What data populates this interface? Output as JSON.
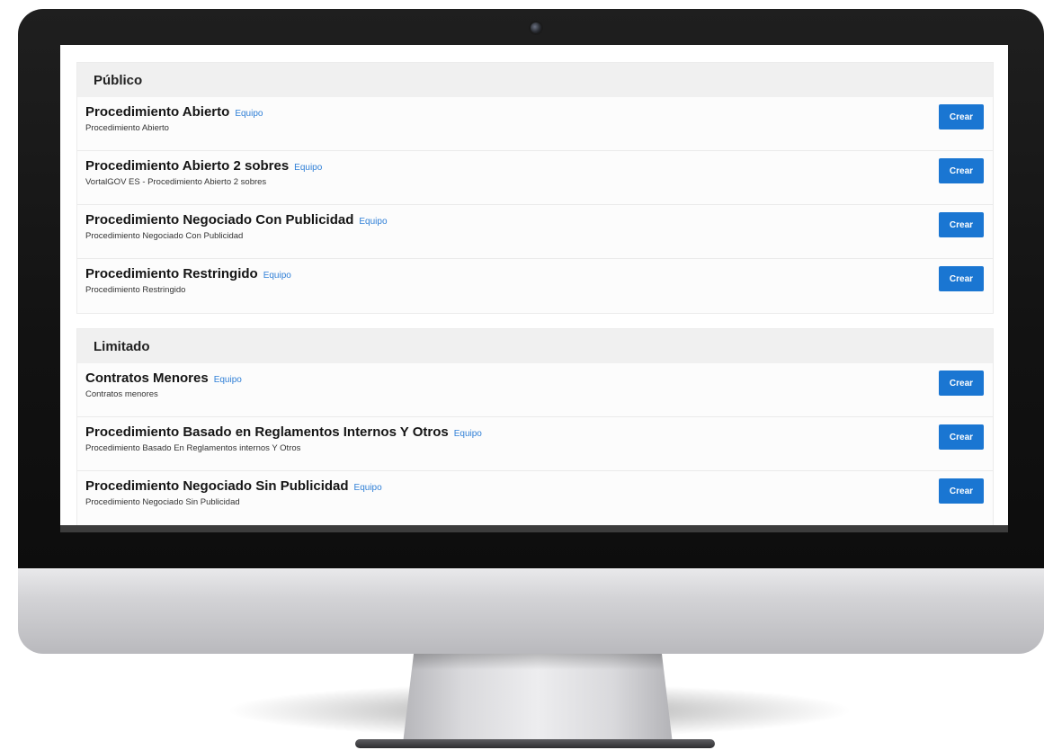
{
  "colors": {
    "accent": "#1a76d2",
    "link": "#2f7fd6",
    "section_header_bg": "#f0f0f0",
    "row_bg": "#fcfcfc",
    "bezel": "#141414"
  },
  "sections": [
    {
      "title": "Público",
      "items": [
        {
          "title": "Procedimiento Abierto",
          "team": "Equipo",
          "subtitle": "Procedimiento Abierto",
          "button": "Crear"
        },
        {
          "title": "Procedimiento Abierto 2 sobres",
          "team": "Equipo",
          "subtitle": "VortalGOV ES - Procedimiento Abierto 2 sobres",
          "button": "Crear"
        },
        {
          "title": "Procedimiento Negociado Con Publicidad",
          "team": "Equipo",
          "subtitle": "Procedimiento Negociado Con Publicidad",
          "button": "Crear"
        },
        {
          "title": "Procedimiento Restringido",
          "team": "Equipo",
          "subtitle": "Procedimiento Restringido",
          "button": "Crear"
        }
      ]
    },
    {
      "title": "Limitado",
      "items": [
        {
          "title": "Contratos Menores",
          "team": "Equipo",
          "subtitle": "Contratos menores",
          "button": "Crear"
        },
        {
          "title": "Procedimiento Basado en Reglamentos Internos Y Otros",
          "team": "Equipo",
          "subtitle": "Procedimiento Basado En Reglamentos internos Y Otros",
          "button": "Crear"
        },
        {
          "title": "Procedimiento Negociado Sin Publicidad",
          "team": "Equipo",
          "subtitle": "Procedimiento Negociado Sin Publicidad",
          "button": "Crear"
        }
      ]
    }
  ]
}
